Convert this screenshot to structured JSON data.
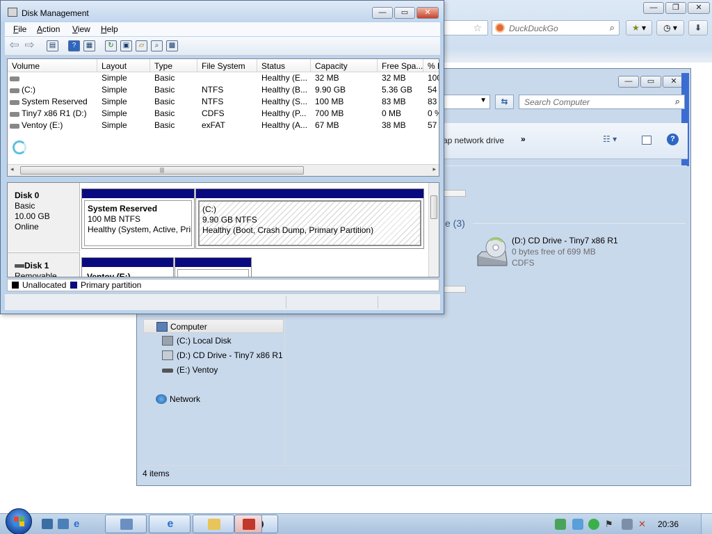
{
  "browser": {
    "search_engine_placeholder": "DuckDuckGo"
  },
  "explorer": {
    "search_placeholder": "Search Computer",
    "cmd_map_network_drive": "ap network drive",
    "cmd_more": "»",
    "group_removable": "e (3)",
    "cd_drive": {
      "name": "(D:) CD Drive - Tiny7 x86 R1",
      "free": "0 bytes free of 699 MB",
      "filesystem": "CDFS"
    },
    "nav": [
      {
        "label": "Computer",
        "icon": "computer-icon"
      },
      {
        "label": "(C:) Local Disk",
        "icon": "local-disk-icon"
      },
      {
        "label": "(D:) CD Drive - Tiny7 x86 R1",
        "icon": "cd-drive-icon"
      },
      {
        "label": "(E:) Ventoy",
        "icon": "removable-drive-icon"
      },
      {
        "label": "Network",
        "icon": "network-icon"
      }
    ],
    "status": "4 items"
  },
  "disk_management": {
    "title": "Disk Management",
    "menu": [
      "File",
      "Action",
      "View",
      "Help"
    ],
    "columns": [
      "Volume",
      "Layout",
      "Type",
      "File System",
      "Status",
      "Capacity",
      "Free Spa...",
      "% F"
    ],
    "rows": [
      [
        "",
        "Simple",
        "Basic",
        "",
        "Healthy (E...",
        "32 MB",
        "32 MB",
        "100"
      ],
      [
        "(C:)",
        "Simple",
        "Basic",
        "NTFS",
        "Healthy (B...",
        "9.90 GB",
        "5.36 GB",
        "54"
      ],
      [
        "System Reserved",
        "Simple",
        "Basic",
        "NTFS",
        "Healthy (S...",
        "100 MB",
        "83 MB",
        "83"
      ],
      [
        "Tiny7 x86 R1 (D:)",
        "Simple",
        "Basic",
        "CDFS",
        "Healthy (P...",
        "700 MB",
        "0 MB",
        "0 %"
      ],
      [
        "Ventoy (E:)",
        "Simple",
        "Basic",
        "exFAT",
        "Healthy (A...",
        "67 MB",
        "38 MB",
        "57"
      ]
    ],
    "disk0": {
      "name": "Disk 0",
      "type": "Basic",
      "size": "10.00 GB",
      "state": "Online",
      "parts": [
        {
          "name": "System Reserved",
          "size": "100 MB NTFS",
          "status": "Healthy (System, Active, Prir"
        },
        {
          "name": "(C:)",
          "size": "9.90 GB NTFS",
          "status": "Healthy (Boot, Crash Dump, Primary Partition)"
        }
      ]
    },
    "disk1": {
      "name": "Disk 1",
      "type": "Removable",
      "parts": [
        {
          "name": "Ventoy  (E:)"
        }
      ]
    },
    "legend": [
      "Unallocated",
      "Primary partition"
    ],
    "colors": {
      "unallocated": "#000000",
      "primary": "#0a0a80"
    }
  },
  "taskbar": {
    "clock": "20:36"
  }
}
